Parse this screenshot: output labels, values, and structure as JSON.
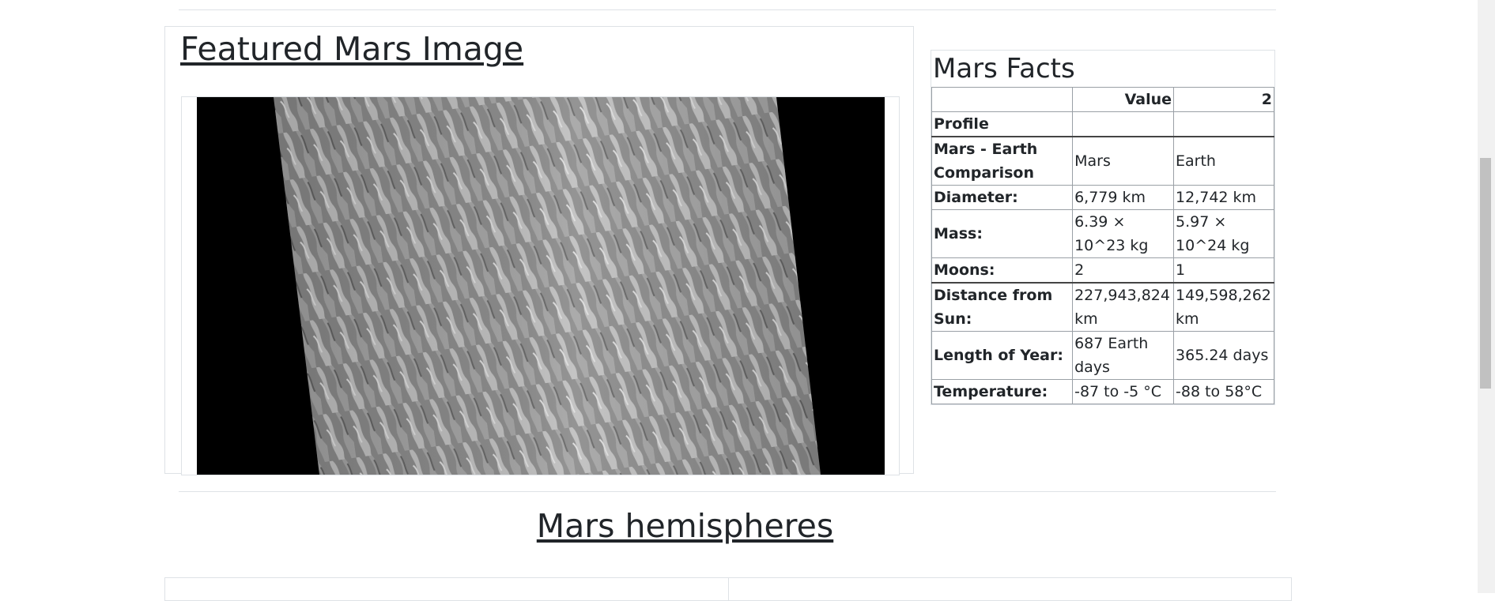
{
  "featured": {
    "title": "Featured Mars Image",
    "image_alt": "Featured Mars image showing rippled dune terrain"
  },
  "facts": {
    "title": "Mars Facts",
    "header": [
      "",
      "Value",
      "2"
    ],
    "rows": [
      [
        "Profile",
        "",
        ""
      ],
      [
        "Mars - Earth Comparison",
        "Mars",
        "Earth"
      ],
      [
        "Diameter:",
        "6,779 km",
        "12,742 km"
      ],
      [
        "Mass:",
        "6.39 × 10^23 kg",
        "5.97 × 10^24 kg"
      ],
      [
        "Moons:",
        "2",
        "1"
      ],
      [
        "Distance from Sun:",
        "227,943,824 km",
        "149,598,262 km"
      ],
      [
        "Length of Year:",
        "687 Earth days",
        "365.24 days"
      ],
      [
        "Temperature:",
        "-87 to -5 °C",
        "-88 to 58°C"
      ]
    ]
  },
  "hemispheres": {
    "title": "Mars hemispheres"
  }
}
